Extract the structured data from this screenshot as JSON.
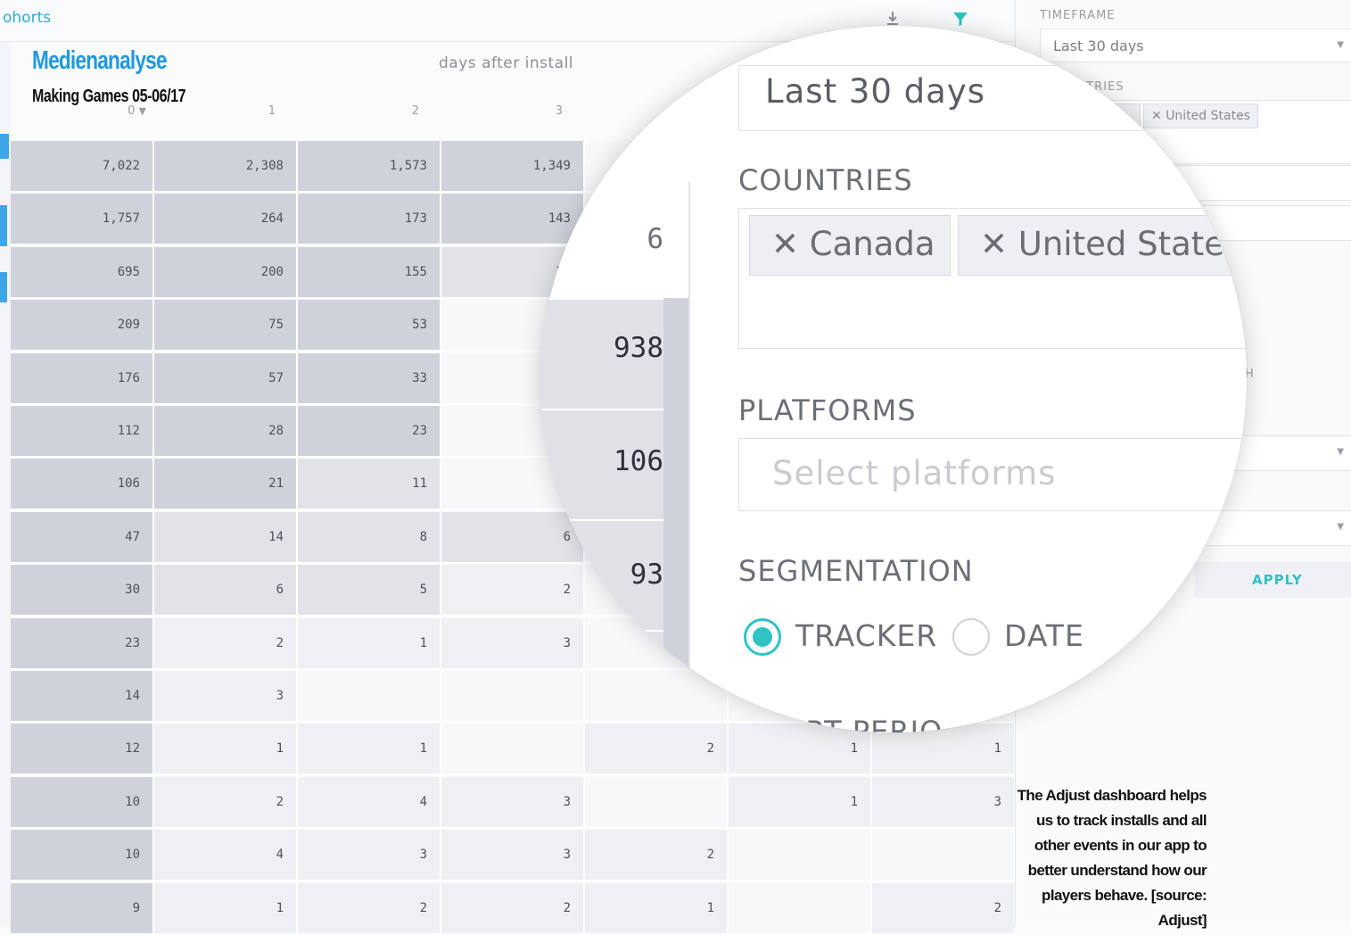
{
  "top_tab": {
    "label": "ohorts"
  },
  "toolbar": {
    "download_icon": "download-icon",
    "filter_icon": "filter-icon"
  },
  "magazine": {
    "title": "Medienanalyse",
    "subtitle": "Making Games 05-06/17"
  },
  "table": {
    "group_label": "days after install",
    "sort_indicator": "▼",
    "headers": [
      "0",
      "1",
      "2",
      "3"
    ],
    "rows": [
      [
        "7,022",
        "2,308",
        "1,573",
        "1,349",
        "",
        "",
        ""
      ],
      [
        "1,757",
        "264",
        "173",
        "143",
        "",
        "",
        ""
      ],
      [
        "695",
        "200",
        "155",
        "11",
        "",
        "",
        ""
      ],
      [
        "209",
        "75",
        "53",
        "",
        "",
        "",
        ""
      ],
      [
        "176",
        "57",
        "33",
        "",
        "",
        "",
        ""
      ],
      [
        "112",
        "28",
        "23",
        "",
        "",
        "",
        ""
      ],
      [
        "106",
        "21",
        "11",
        "",
        "",
        "",
        ""
      ],
      [
        "47",
        "14",
        "8",
        "6",
        "",
        "",
        ""
      ],
      [
        "30",
        "6",
        "5",
        "2",
        "",
        "",
        ""
      ],
      [
        "23",
        "2",
        "1",
        "3",
        "",
        "",
        ""
      ],
      [
        "14",
        "3",
        "",
        "",
        "",
        "",
        ""
      ],
      [
        "12",
        "1",
        "1",
        "",
        "2",
        "1",
        "1"
      ],
      [
        "10",
        "2",
        "4",
        "3",
        "",
        "1",
        "3"
      ],
      [
        "10",
        "4",
        "3",
        "3",
        "2",
        "",
        ""
      ],
      [
        "9",
        "1",
        "2",
        "2",
        "1",
        "",
        "2"
      ]
    ]
  },
  "sidebar": {
    "timeframe_label": "TIMEFRAME",
    "timeframe_value": "Last 30 days",
    "countries_label": "UNTRIES",
    "country_tags": [
      "da",
      "United States"
    ],
    "partial_letter": "H",
    "apply_label": "APPLY"
  },
  "magnifier": {
    "timeframe_value": "Last 30 days",
    "countries_label": "COUNTRIES",
    "country_tags": [
      "Canada",
      "United State"
    ],
    "platforms_label": "PLATFORMS",
    "platforms_placeholder": "Select platforms",
    "segmentation_label": "SEGMENTATION",
    "segmentation_options": [
      "TRACKER",
      "DATE"
    ],
    "segmentation_selected": "TRACKER",
    "cohort_period_label": "HORT PERIO",
    "column_values": [
      "6",
      "938",
      "106",
      "93"
    ]
  },
  "caption": "The Adjust dashboard helps us to track installs and all other events in our app to better understand how our players behave. [source: Adjust]",
  "colors": {
    "accent_teal": "#2fc3c4",
    "magazine_blue": "#1f99df",
    "cell_dark": "#cfd2db",
    "cell_mid": "#e1e3e8",
    "cell_light": "#eef0f3"
  }
}
